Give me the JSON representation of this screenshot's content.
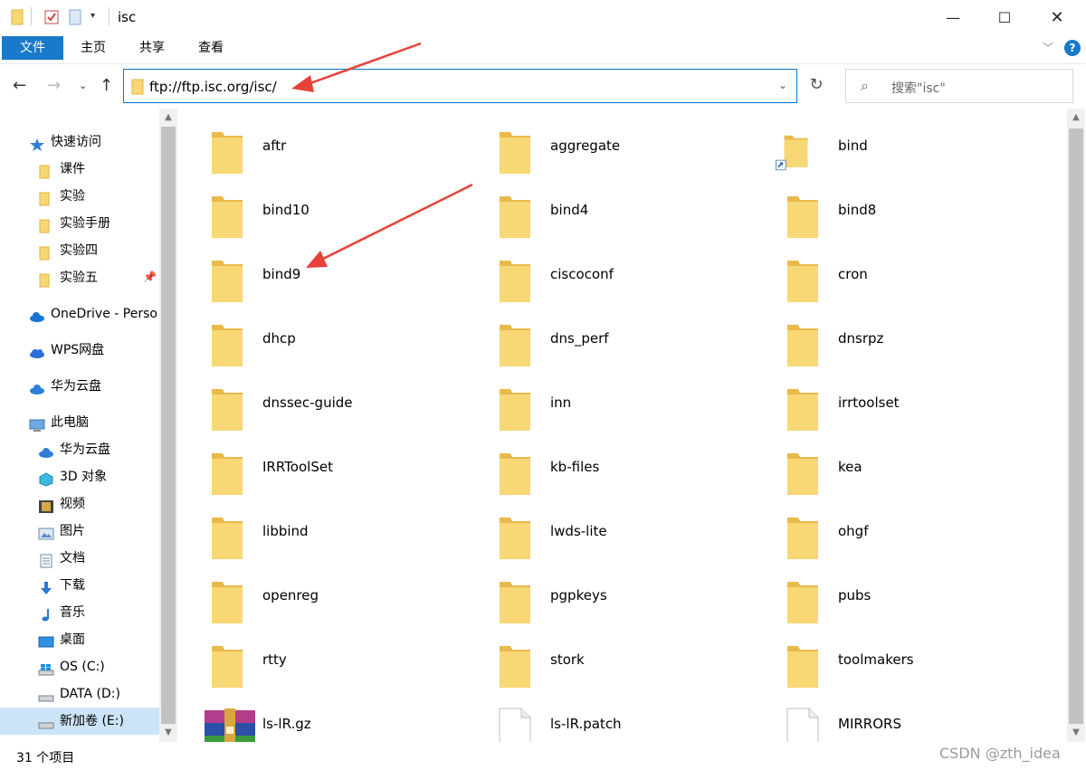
{
  "window": {
    "title": "isc"
  },
  "ribbon": {
    "tabs": [
      "文件",
      "主页",
      "共享",
      "查看"
    ]
  },
  "address": {
    "path": "ftp://ftp.isc.org/isc/",
    "search_placeholder": "搜索\"isc\""
  },
  "sidebar": {
    "quick_access": "快速访问",
    "quick_items": [
      "课件",
      "实验",
      "实验手册",
      "实验四",
      "实验五"
    ],
    "onedrive": "OneDrive - Perso",
    "wps": "WPS网盘",
    "huawei": "华为云盘",
    "this_pc": "此电脑",
    "pc_items": [
      "华为云盘",
      "3D 对象",
      "视频",
      "图片",
      "文档",
      "下载",
      "音乐",
      "桌面",
      "OS (C:)",
      "DATA (D:)",
      "新加卷 (E:)"
    ]
  },
  "files": [
    {
      "name": "aftr",
      "type": "folder"
    },
    {
      "name": "aggregate",
      "type": "folder"
    },
    {
      "name": "bind",
      "type": "folder-shortcut"
    },
    {
      "name": "bind10",
      "type": "folder"
    },
    {
      "name": "bind4",
      "type": "folder"
    },
    {
      "name": "bind8",
      "type": "folder"
    },
    {
      "name": "bind9",
      "type": "folder"
    },
    {
      "name": "ciscoconf",
      "type": "folder"
    },
    {
      "name": "cron",
      "type": "folder"
    },
    {
      "name": "dhcp",
      "type": "folder"
    },
    {
      "name": "dns_perf",
      "type": "folder"
    },
    {
      "name": "dnsrpz",
      "type": "folder"
    },
    {
      "name": "dnssec-guide",
      "type": "folder"
    },
    {
      "name": "inn",
      "type": "folder"
    },
    {
      "name": "irrtoolset",
      "type": "folder"
    },
    {
      "name": "IRRToolSet",
      "type": "folder"
    },
    {
      "name": "kb-files",
      "type": "folder"
    },
    {
      "name": "kea",
      "type": "folder"
    },
    {
      "name": "libbind",
      "type": "folder"
    },
    {
      "name": "lwds-lite",
      "type": "folder"
    },
    {
      "name": "ohgf",
      "type": "folder"
    },
    {
      "name": "openreg",
      "type": "folder"
    },
    {
      "name": "pgpkeys",
      "type": "folder"
    },
    {
      "name": "pubs",
      "type": "folder"
    },
    {
      "name": "rtty",
      "type": "folder"
    },
    {
      "name": "stork",
      "type": "folder"
    },
    {
      "name": "toolmakers",
      "type": "folder"
    },
    {
      "name": "ls-lR.gz",
      "type": "archive"
    },
    {
      "name": "ls-lR.patch",
      "type": "file"
    },
    {
      "name": "MIRRORS",
      "type": "file"
    }
  ],
  "status": {
    "count": "31 个项目",
    "watermark": "CSDN @zth_idea"
  },
  "colors": {
    "accent": "#1979ca",
    "folder": "#f8d775",
    "folder_dark": "#e9b949",
    "selection": "#cce4f7",
    "arrow": "#e8413a"
  }
}
